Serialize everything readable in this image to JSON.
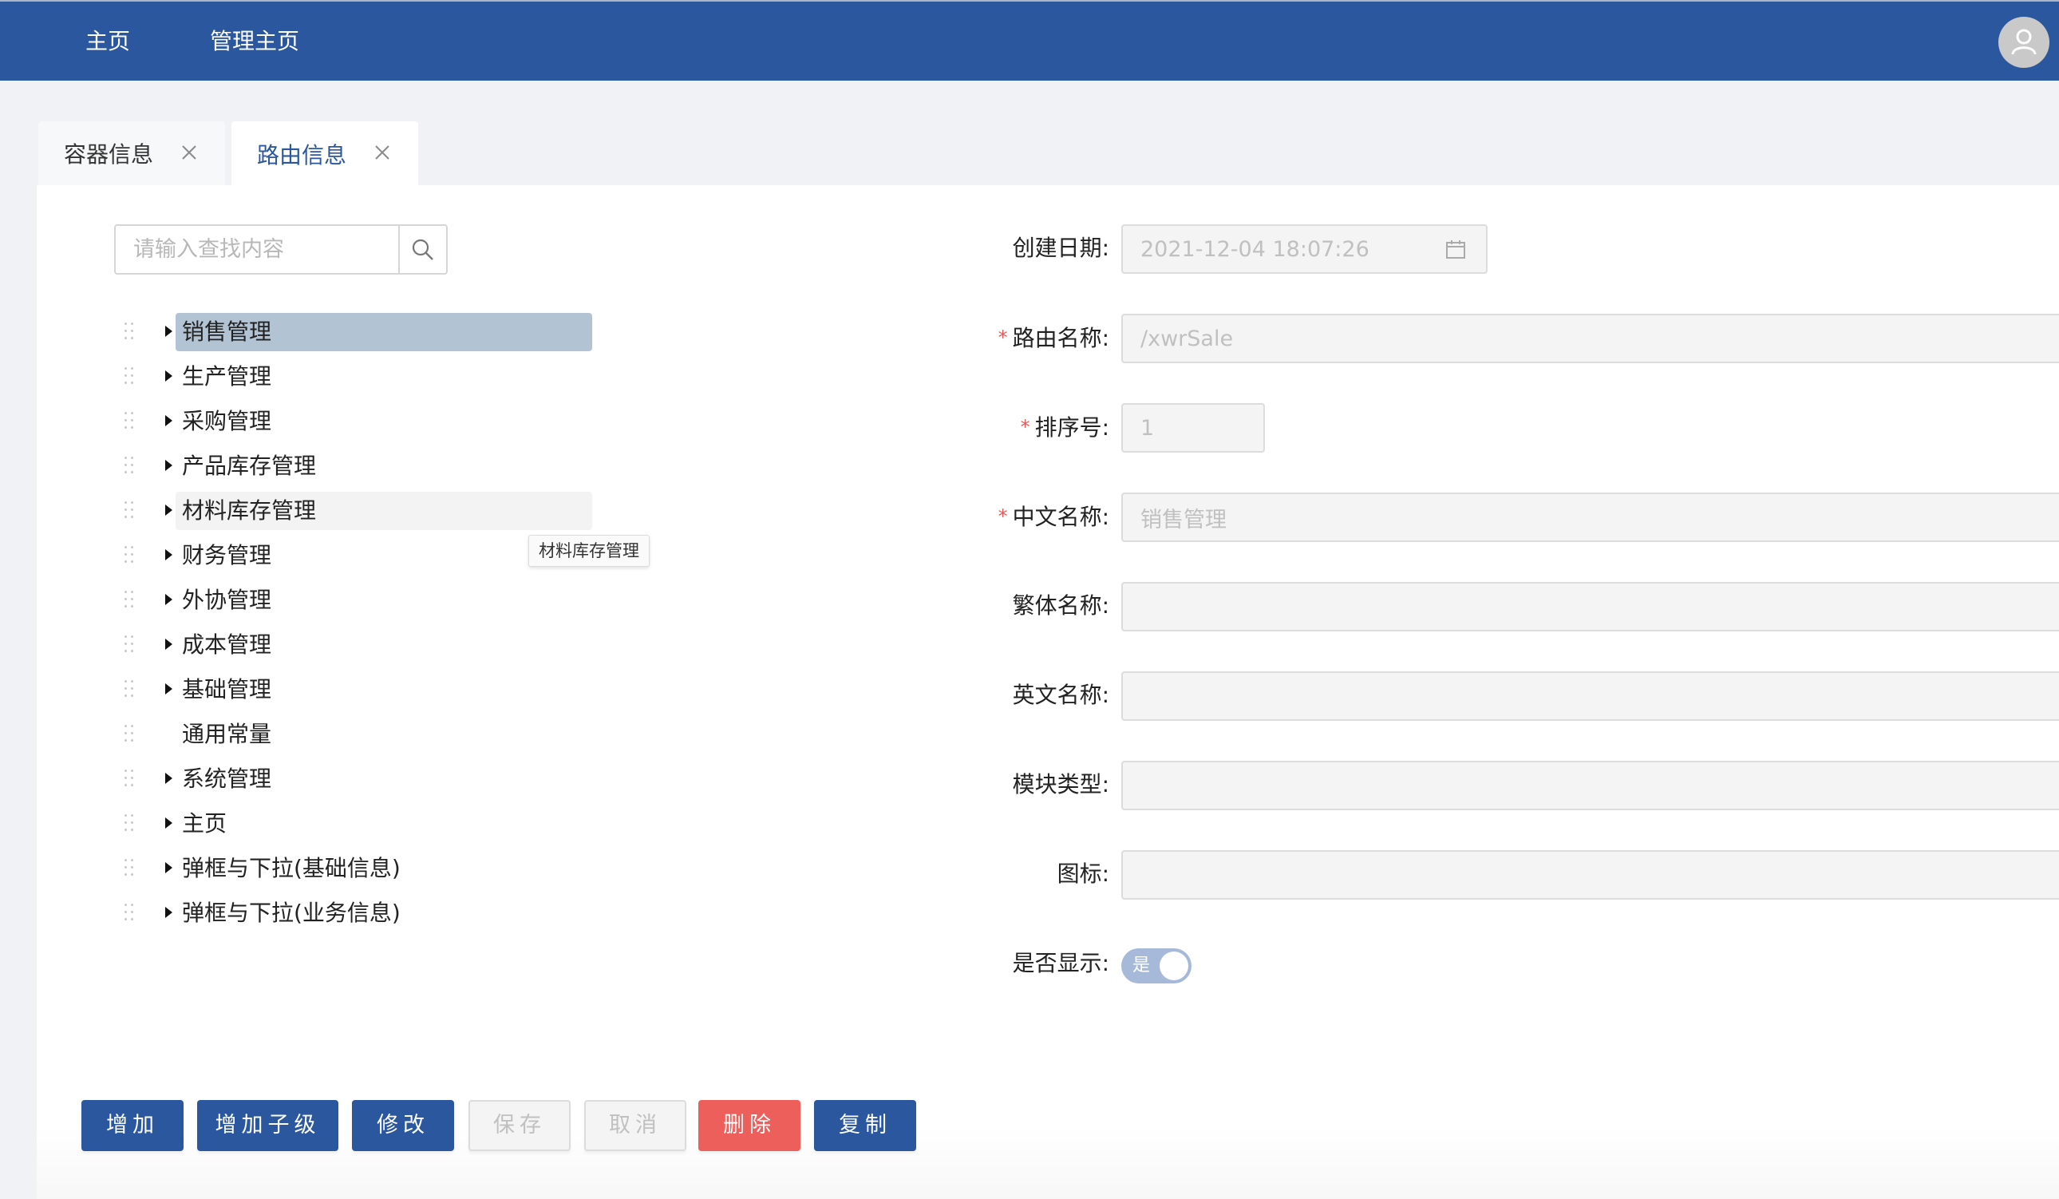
{
  "header": {
    "nav": [
      {
        "label": "主页"
      },
      {
        "label": "管理主页"
      }
    ],
    "avatar_icon": "user-icon",
    "color": "#2b579e"
  },
  "tabs": [
    {
      "label": "容器信息",
      "active": false
    },
    {
      "label": "路由信息",
      "active": true
    }
  ],
  "search": {
    "placeholder": "请输入查找内容",
    "value": ""
  },
  "tree": {
    "selected": "销售管理",
    "hovered": "材料库存管理",
    "tooltip": "材料库存管理",
    "nodes": [
      {
        "label": "销售管理",
        "has_children": true
      },
      {
        "label": "生产管理",
        "has_children": true
      },
      {
        "label": "采购管理",
        "has_children": true
      },
      {
        "label": "产品库存管理",
        "has_children": true
      },
      {
        "label": "材料库存管理",
        "has_children": true
      },
      {
        "label": "财务管理",
        "has_children": true
      },
      {
        "label": "外协管理",
        "has_children": true
      },
      {
        "label": "成本管理",
        "has_children": true
      },
      {
        "label": "基础管理",
        "has_children": true
      },
      {
        "label": "通用常量",
        "has_children": false
      },
      {
        "label": "系统管理",
        "has_children": true
      },
      {
        "label": "主页",
        "has_children": true
      },
      {
        "label": "弹框与下拉(基础信息)",
        "has_children": true
      },
      {
        "label": "弹框与下拉(业务信息)",
        "has_children": true
      }
    ]
  },
  "form": {
    "created_date": {
      "label": "创建日期:",
      "value": "2021-12-04 18:07:26",
      "required": false
    },
    "route_name": {
      "label": "路由名称:",
      "value": "/xwrSale",
      "required": true
    },
    "sort_no": {
      "label": "排序号:",
      "value": "1",
      "required": true
    },
    "chinese_name": {
      "label": "中文名称:",
      "value": "销售管理",
      "required": true
    },
    "traditional_name": {
      "label": "繁体名称:",
      "value": "",
      "required": false
    },
    "english_name": {
      "label": "英文名称:",
      "value": "",
      "required": false
    },
    "module_type": {
      "label": "模块类型:",
      "value": "",
      "required": false
    },
    "icon": {
      "label": "图标:",
      "value": "",
      "required": false
    },
    "visible": {
      "label": "是否显示:",
      "value": true,
      "on_text": "是"
    },
    "required_mark": "*"
  },
  "buttons": {
    "add": "增加",
    "add_child": "增加子级",
    "edit": "修改",
    "save": "保存",
    "cancel": "取消",
    "delete": "删除",
    "copy": "复制"
  },
  "colors": {
    "primary": "#2b579e",
    "danger": "#ec5f5b",
    "selected_node": "#b2c3d4",
    "switch_on": "#a6b9d9",
    "required": "#ee5555"
  }
}
